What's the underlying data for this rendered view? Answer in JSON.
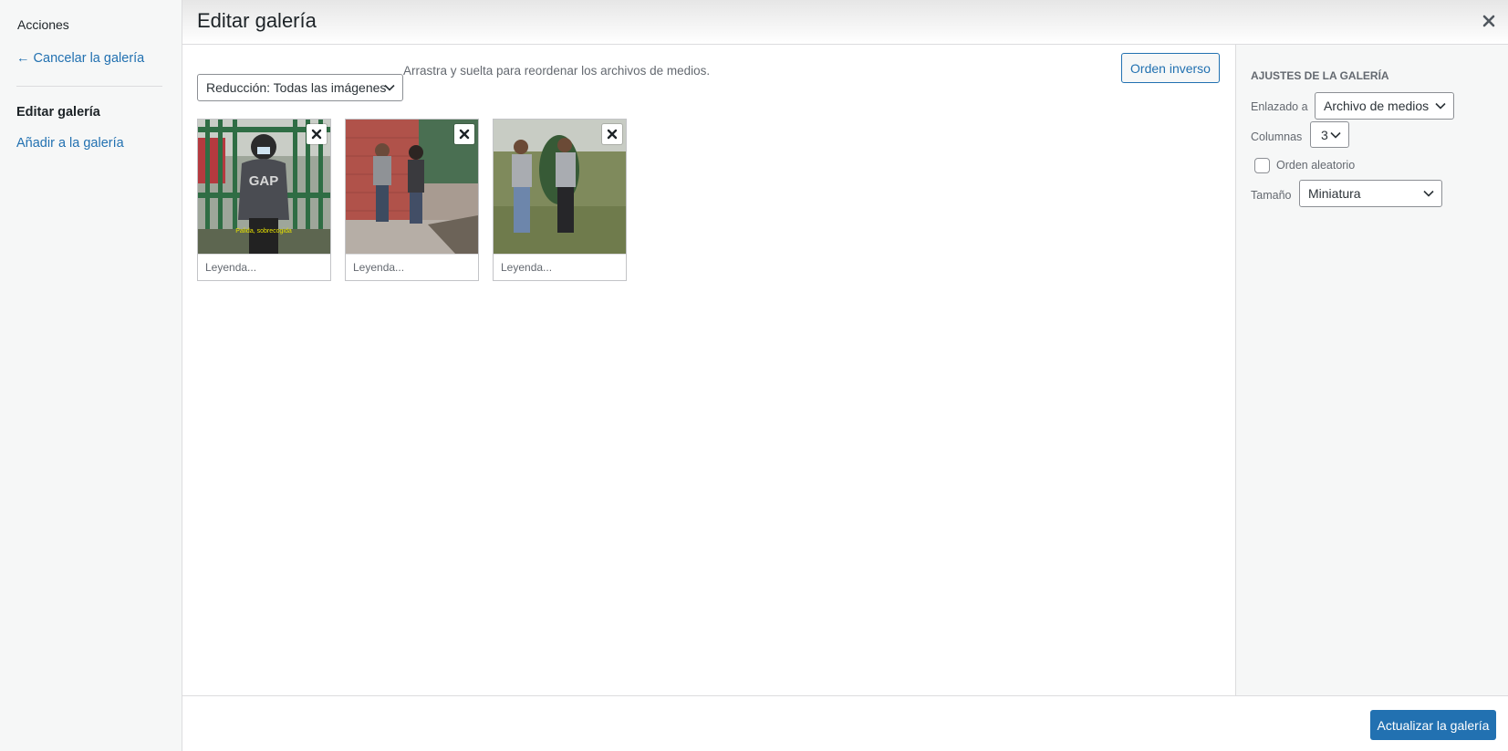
{
  "menu": {
    "heading": "Acciones",
    "cancel": "← Cancelar la galería",
    "edit": "Editar galería",
    "add": "Añadir a la galería"
  },
  "frame": {
    "title": "Editar galería",
    "close_icon": "close-icon"
  },
  "toolbar": {
    "filter_value": "Reducción: Todas las imágenes",
    "instructions": "Arrastra y suelta para reordenar los archivos de medios.",
    "reverse_label": "Orden inverso"
  },
  "attachments": [
    {
      "caption_placeholder": "Leyenda...",
      "overlay_text": "Palida, sobrecogida"
    },
    {
      "caption_placeholder": "Leyenda..."
    },
    {
      "caption_placeholder": "Leyenda..."
    }
  ],
  "settings": {
    "heading": "Ajustes de la galería",
    "link_label": "Enlazado a",
    "link_value": "Archivo de medios",
    "columns_label": "Columnas",
    "columns_value": "3",
    "random_label": "Orden aleatorio",
    "size_label": "Tamaño",
    "size_value": "Miniatura"
  },
  "footer": {
    "update_label": "Actualizar la galería"
  },
  "colors": {
    "accent": "#2271b1",
    "sidebar_bg": "#f6f7f7"
  }
}
